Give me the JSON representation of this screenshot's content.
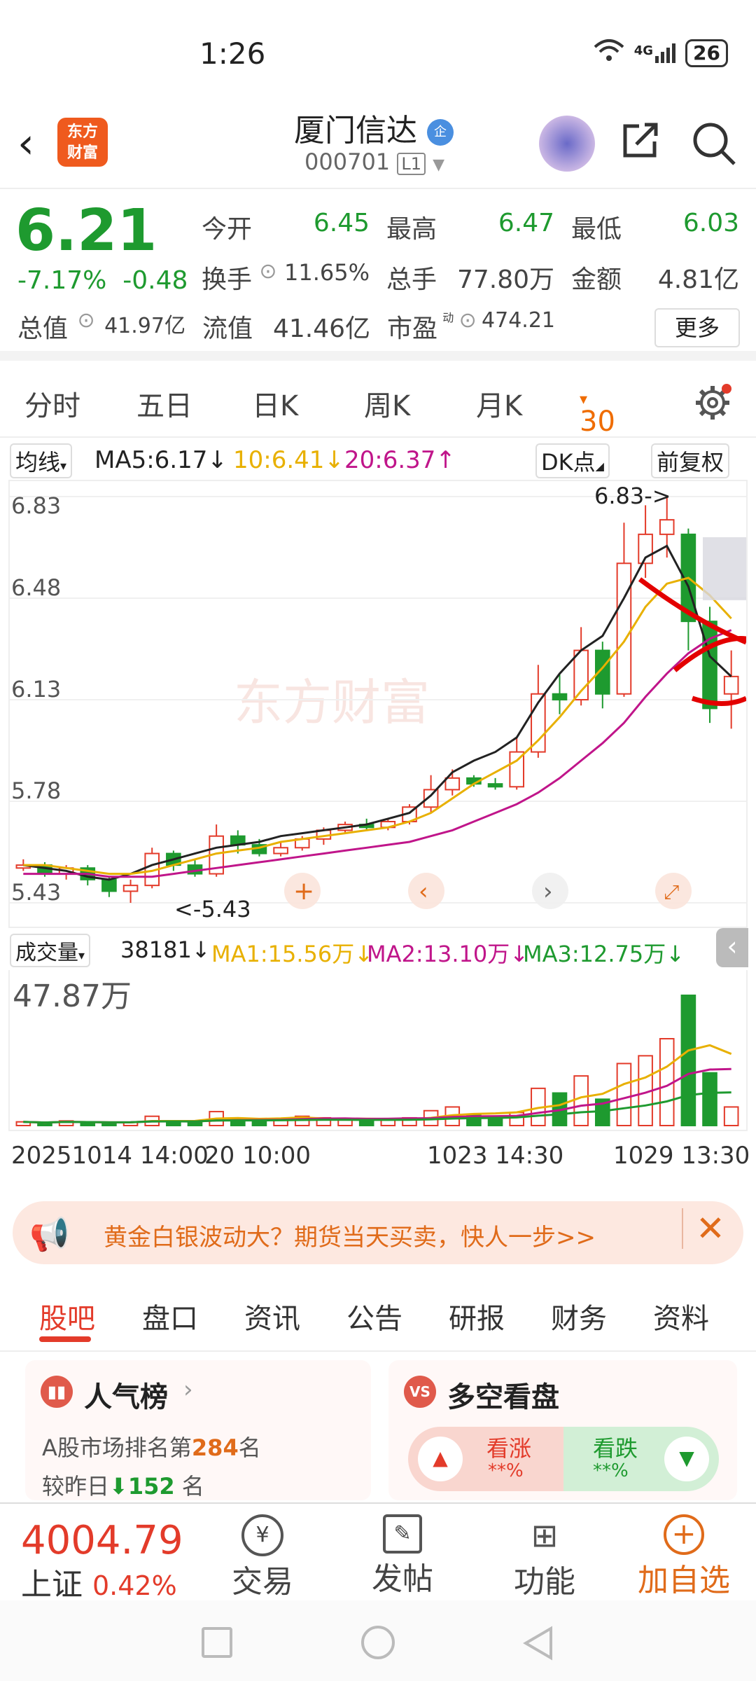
{
  "status_bar": {
    "time": "1:26",
    "network": "4G",
    "battery": "26"
  },
  "header": {
    "logo_text": "东方财富",
    "title": "厦门信达",
    "badge": "企",
    "code": "000701",
    "level": "L1"
  },
  "quote": {
    "price": "6.21",
    "change_pct": "-7.17%",
    "change": "-0.48",
    "open_label": "今开",
    "open": "6.45",
    "high_label": "最高",
    "high": "6.47",
    "low_label": "最低",
    "low": "6.03",
    "turnover_label": "换手",
    "turnover": "11.65%",
    "volume_label": "总手",
    "volume": "77.80万",
    "amount_label": "金额",
    "amount": "4.81亿",
    "total_cap_label": "总值",
    "total_cap": "41.97亿",
    "float_cap_label": "流值",
    "float_cap": "41.46亿",
    "pe_label": "市盈",
    "pe_sup": "动",
    "pe": "474.21",
    "more": "更多"
  },
  "period_tabs": [
    "分时",
    "五日",
    "日K",
    "周K",
    "月K",
    "30分"
  ],
  "ma_bar": {
    "type": "均线",
    "ma5": "MA5:6.17↓",
    "ma10": "10:6.41↓",
    "ma20": "20:6.37↑",
    "dk": "DK点",
    "adjust": "前复权"
  },
  "chart_data": {
    "type": "line",
    "y_ticks": [
      "6.83",
      "6.48",
      "6.13",
      "5.78",
      "5.43"
    ],
    "ylim": [
      5.43,
      6.83
    ],
    "high_annotation": "6.83->",
    "low_annotation": "<-5.43",
    "watermark": "东方财富",
    "series": [
      {
        "name": "MA5",
        "color": "#222222",
        "values": [
          5.56,
          5.55,
          5.54,
          5.52,
          5.51,
          5.53,
          5.56,
          5.58,
          5.6,
          5.62,
          5.63,
          5.64,
          5.66,
          5.67,
          5.68,
          5.69,
          5.7,
          5.72,
          5.74,
          5.8,
          5.88,
          5.92,
          5.95,
          6.0,
          6.12,
          6.22,
          6.3,
          6.35,
          6.48,
          6.62,
          6.66,
          6.52,
          6.28,
          6.21
        ]
      },
      {
        "name": "MA10",
        "color": "#e8b000",
        "values": [
          5.56,
          5.56,
          5.55,
          5.54,
          5.53,
          5.53,
          5.54,
          5.56,
          5.58,
          5.6,
          5.61,
          5.62,
          5.64,
          5.65,
          5.66,
          5.67,
          5.68,
          5.69,
          5.71,
          5.74,
          5.79,
          5.84,
          5.88,
          5.92,
          5.99,
          6.07,
          6.16,
          6.24,
          6.33,
          6.45,
          6.53,
          6.55,
          6.49,
          6.41
        ]
      },
      {
        "name": "MA20",
        "color": "#c0158a",
        "values": [
          5.53,
          5.53,
          5.53,
          5.53,
          5.52,
          5.52,
          5.52,
          5.53,
          5.54,
          5.55,
          5.56,
          5.57,
          5.58,
          5.59,
          5.6,
          5.61,
          5.62,
          5.63,
          5.64,
          5.66,
          5.68,
          5.71,
          5.74,
          5.77,
          5.81,
          5.86,
          5.92,
          5.98,
          6.05,
          6.14,
          6.22,
          6.29,
          6.34,
          6.37
        ]
      }
    ],
    "candles": [
      [
        5.55,
        5.56,
        5.54,
        5.58
      ],
      [
        5.56,
        5.53,
        5.52,
        5.57
      ],
      [
        5.53,
        5.55,
        5.51,
        5.56
      ],
      [
        5.55,
        5.51,
        5.49,
        5.56
      ],
      [
        5.51,
        5.47,
        5.45,
        5.52
      ],
      [
        5.47,
        5.49,
        5.43,
        5.51
      ],
      [
        5.49,
        5.6,
        5.48,
        5.62
      ],
      [
        5.6,
        5.56,
        5.54,
        5.61
      ],
      [
        5.56,
        5.53,
        5.52,
        5.58
      ],
      [
        5.53,
        5.66,
        5.52,
        5.7
      ],
      [
        5.66,
        5.63,
        5.6,
        5.68
      ],
      [
        5.63,
        5.6,
        5.59,
        5.65
      ],
      [
        5.6,
        5.62,
        5.59,
        5.64
      ],
      [
        5.62,
        5.65,
        5.61,
        5.66
      ],
      [
        5.65,
        5.68,
        5.63,
        5.69
      ],
      [
        5.68,
        5.7,
        5.67,
        5.71
      ],
      [
        5.7,
        5.69,
        5.68,
        5.72
      ],
      [
        5.69,
        5.71,
        5.68,
        5.72
      ],
      [
        5.71,
        5.76,
        5.7,
        5.77
      ],
      [
        5.76,
        5.82,
        5.74,
        5.87
      ],
      [
        5.82,
        5.86,
        5.8,
        5.89
      ],
      [
        5.86,
        5.84,
        5.83,
        5.87
      ],
      [
        5.84,
        5.83,
        5.82,
        5.86
      ],
      [
        5.83,
        5.95,
        5.82,
        6.0
      ],
      [
        5.95,
        6.15,
        5.93,
        6.25
      ],
      [
        6.15,
        6.13,
        6.08,
        6.22
      ],
      [
        6.13,
        6.3,
        6.11,
        6.38
      ],
      [
        6.3,
        6.15,
        6.1,
        6.33
      ],
      [
        6.15,
        6.6,
        6.14,
        6.74
      ],
      [
        6.6,
        6.7,
        6.55,
        6.8
      ],
      [
        6.7,
        6.75,
        6.62,
        6.83
      ],
      [
        6.7,
        6.4,
        6.3,
        6.72
      ],
      [
        6.4,
        6.1,
        6.05,
        6.45
      ],
      [
        6.15,
        6.21,
        6.03,
        6.3
      ]
    ],
    "volume": {
      "label": "成交量",
      "current": "38181↓",
      "ma1": "MA1:15.56万↓",
      "ma2": "MA2:13.10万↓",
      "ma3": "MA3:12.75万↓",
      "max_label": "47.87万",
      "values": [
        1.2,
        0.8,
        1.5,
        1.0,
        0.7,
        1.1,
        3.0,
        1.5,
        1.2,
        4.5,
        2.0,
        1.6,
        2.2,
        3.0,
        2.5,
        1.8,
        1.4,
        1.9,
        2.5,
        4.8,
        6.0,
        3.5,
        2.8,
        4.2,
        12.0,
        10.5,
        16.0,
        8.5,
        20.0,
        22.5,
        28.0,
        42.0,
        17.0,
        6.0
      ],
      "up": [
        true,
        false,
        true,
        false,
        false,
        true,
        true,
        false,
        false,
        true,
        false,
        false,
        true,
        true,
        true,
        true,
        false,
        true,
        true,
        true,
        true,
        false,
        false,
        true,
        true,
        false,
        true,
        false,
        true,
        true,
        true,
        false,
        false,
        true
      ]
    },
    "dates": [
      "20251014 14:00",
      "20 10:00",
      "1023 14:30",
      "1029 13:30"
    ]
  },
  "ad": {
    "text": "黄金白银波动大？期货当天买卖，快人一步>>"
  },
  "sub_tabs": [
    "股吧",
    "盘口",
    "资讯",
    "公告",
    "研报",
    "财务",
    "资料"
  ],
  "popularity": {
    "title": "人气榜",
    "line1_prefix": "A股市场排名第",
    "rank": "284",
    "line1_suffix": "名",
    "line2_prefix": "较昨日",
    "change": "152",
    "line2_suffix": "名"
  },
  "bullbear": {
    "title": "多空看盘",
    "up_label": "看涨",
    "up_value": "**%",
    "down_label": "看跌",
    "down_value": "**%"
  },
  "bottom": {
    "index_value": "4004.79",
    "index_name": "上证",
    "index_change": "0.42%",
    "trade": "交易",
    "post": "发帖",
    "func": "功能",
    "add": "加自选"
  }
}
